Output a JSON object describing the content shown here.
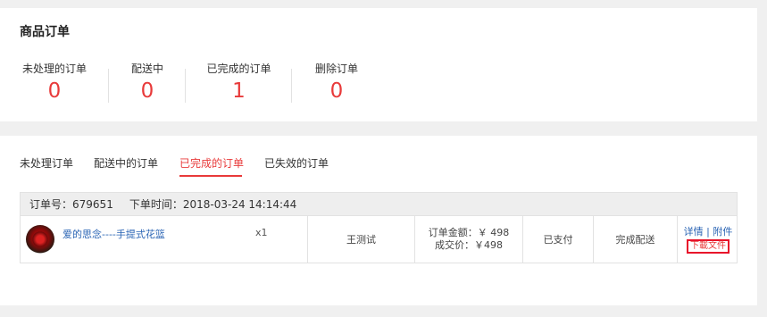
{
  "goods_orders": {
    "title": "商品订单",
    "stats": [
      {
        "label": "未处理的订单",
        "value": "0"
      },
      {
        "label": "配送中",
        "value": "0"
      },
      {
        "label": "已完成的订单",
        "value": "1"
      },
      {
        "label": "删除订单",
        "value": "0"
      }
    ]
  },
  "tabs": [
    "未处理订单",
    "配送中的订单",
    "已完成的订单",
    "已失效的订单"
  ],
  "active_tab": "已完成的订单",
  "order": {
    "no_label": "订单号：",
    "no": "679651",
    "time_label": "下单时间：",
    "time": "2018-03-24 14:14:44",
    "product_name": "爱的思念----手提式花篮",
    "quantity": "x1",
    "recipient": "王测试",
    "amount_line": "订单金额：￥ 498",
    "paid_line": "成交价：￥498",
    "payment_status": "已支付",
    "delivery_status": "完成配送",
    "detail_links": "详情 | 附件",
    "download_label": "下載文件"
  },
  "colors": {
    "accent": "#e83a3a",
    "link": "#2a64b4"
  }
}
